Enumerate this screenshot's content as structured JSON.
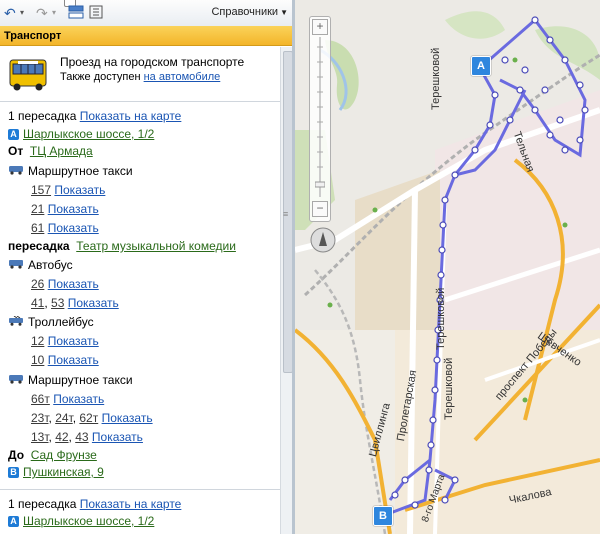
{
  "toolbar": {
    "references_label": "Справочники"
  },
  "panel": {
    "title": "Транспорт",
    "header": {
      "title": "Проезд на городском транспорте",
      "sub_prefix": "Также доступен",
      "sub_link": "на автомобиле"
    },
    "route1": {
      "transfers": "1 пересадка",
      "show_on_map": "Показать на карте",
      "start_badge": "A",
      "start_address": "Шарлыкское шоссе, 1/2",
      "from_label": "От",
      "from_place": "ТЦ Армада",
      "leg1_type": "Маршрутное такси",
      "leg1_routes": [
        {
          "num": "157",
          "show": "Показать"
        },
        {
          "num": "21",
          "show": "Показать"
        },
        {
          "num": "61",
          "show": "Показать"
        }
      ],
      "transfer_label": "пересадка",
      "transfer_place": "Театр музыкальной комедии",
      "leg2_type": "Автобус",
      "leg2_routes": [
        {
          "nums": [
            "26"
          ],
          "show": "Показать"
        },
        {
          "nums": [
            "41",
            "53"
          ],
          "show": "Показать"
        }
      ],
      "leg3_type": "Троллейбус",
      "leg3_routes": [
        {
          "nums": [
            "12"
          ],
          "show": "Показать"
        },
        {
          "nums": [
            "10"
          ],
          "show": "Показать"
        }
      ],
      "leg4_type": "Маршрутное такси",
      "leg4_routes": [
        {
          "nums": [
            "66т"
          ],
          "show": "Показать"
        },
        {
          "nums": [
            "23т",
            "24т",
            "62т"
          ],
          "show": "Показать"
        },
        {
          "nums": [
            "13т",
            "42",
            "43"
          ],
          "show": "Показать"
        }
      ],
      "to_label": "До",
      "to_place": "Сад Фрунзе",
      "end_badge": "B",
      "end_address": "Пушкинская, 9"
    },
    "route2": {
      "transfers": "1 пересадка",
      "show_on_map": "Показать на карте",
      "start_badge": "A",
      "start_address": "Шарлыкское шоссе, 1/2"
    }
  },
  "map": {
    "pin_a": "A",
    "pin_b": "B",
    "streets": {
      "tereshkovoy_top": "Терешковой",
      "tereshkovoy_mid": "Терешковой",
      "tereshkovoy_bottom": "Терешковой",
      "proletarskaya": "Пролетарская",
      "tsvillinga": "Цвиллинга",
      "pobedy": "проспект Победы",
      "shevchenko": "Шевченко",
      "chkalova": "Чкалова",
      "tyulnaya": "Тельная",
      "8marta": "8-го Марта"
    }
  }
}
